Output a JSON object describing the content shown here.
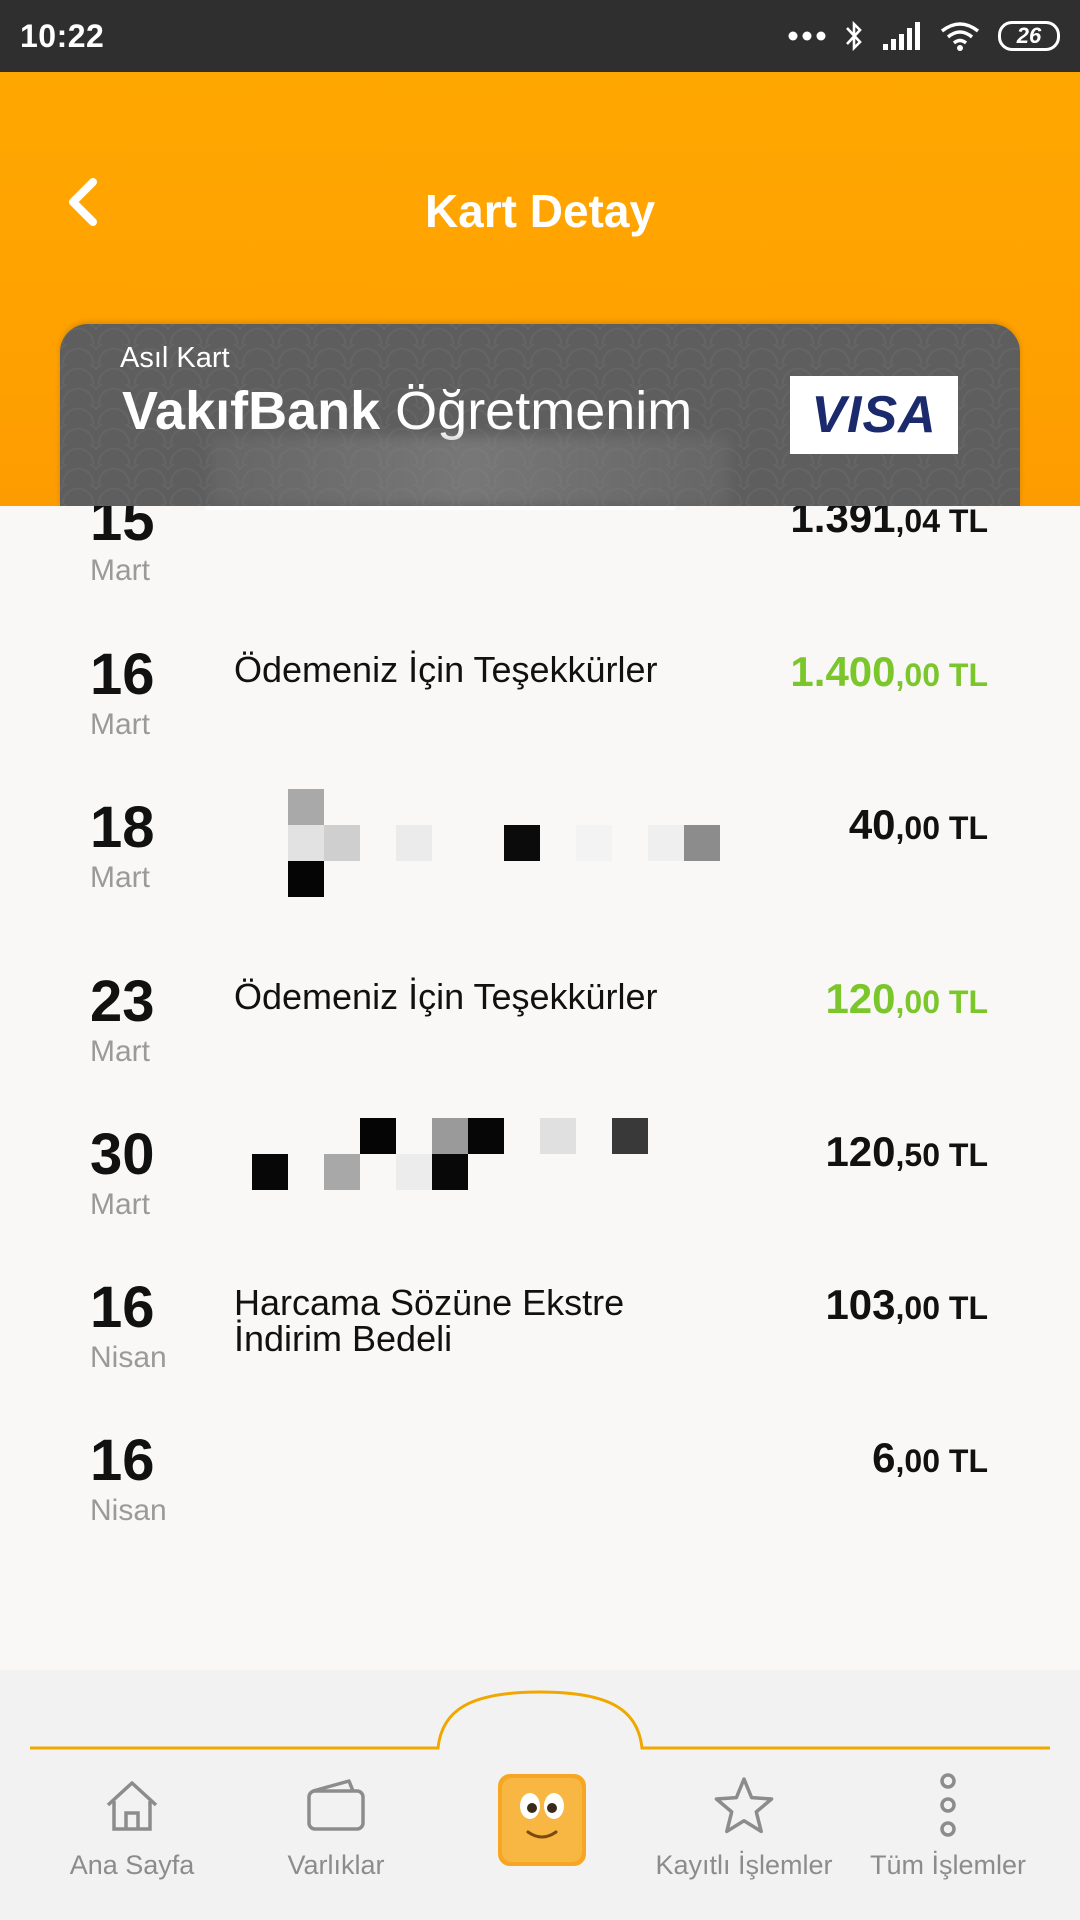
{
  "status_bar": {
    "time": "10:22",
    "battery": "26"
  },
  "header": {
    "title": "Kart Detay"
  },
  "card": {
    "type_label": "Asıl Kart",
    "brand": "VakıfBank",
    "product": "Öğretmenim",
    "network_logo": "VISA"
  },
  "transactions": [
    {
      "day": "15",
      "month": "Mart",
      "description": "",
      "amount_whole": "1.391",
      "amount_cents": ",04 TL",
      "kind": "debit"
    },
    {
      "day": "16",
      "month": "Mart",
      "description": "Ödemeniz İçin Teşekkürler",
      "amount_whole": "1.400",
      "amount_cents": ",00 TL",
      "kind": "credit"
    },
    {
      "day": "18",
      "month": "Mart",
      "description": "",
      "amount_whole": "40",
      "amount_cents": ",00 TL",
      "kind": "debit"
    },
    {
      "day": "23",
      "month": "Mart",
      "description": "Ödemeniz İçin Teşekkürler",
      "amount_whole": "120",
      "amount_cents": ",00 TL",
      "kind": "credit"
    },
    {
      "day": "30",
      "month": "Mart",
      "description": "",
      "amount_whole": "120",
      "amount_cents": ",50 TL",
      "kind": "debit"
    },
    {
      "day": "16",
      "month": "Nisan",
      "description": "Harcama Sözüne Ekstre\nİndirim Bedeli",
      "amount_whole": "103",
      "amount_cents": ",00 TL",
      "kind": "debit"
    },
    {
      "day": "16",
      "month": "Nisan",
      "description": "",
      "amount_whole": "6",
      "amount_cents": ",00 TL",
      "kind": "debit"
    }
  ],
  "bottom_nav": {
    "items": [
      {
        "label": "Ana Sayfa",
        "icon": "home-icon"
      },
      {
        "label": "Varlıklar",
        "icon": "wallet-icon"
      },
      {
        "label": "",
        "icon": "mascot-icon"
      },
      {
        "label": "Kayıtlı İşlemler",
        "icon": "star-icon"
      },
      {
        "label": "Tüm İşlemler",
        "icon": "more-vertical-icon"
      }
    ]
  },
  "colors": {
    "header_orange": "#ffa200",
    "credit_green": "#7bc72b",
    "card_gray": "#5e5e5e",
    "nav_accent": "#f0a800"
  }
}
